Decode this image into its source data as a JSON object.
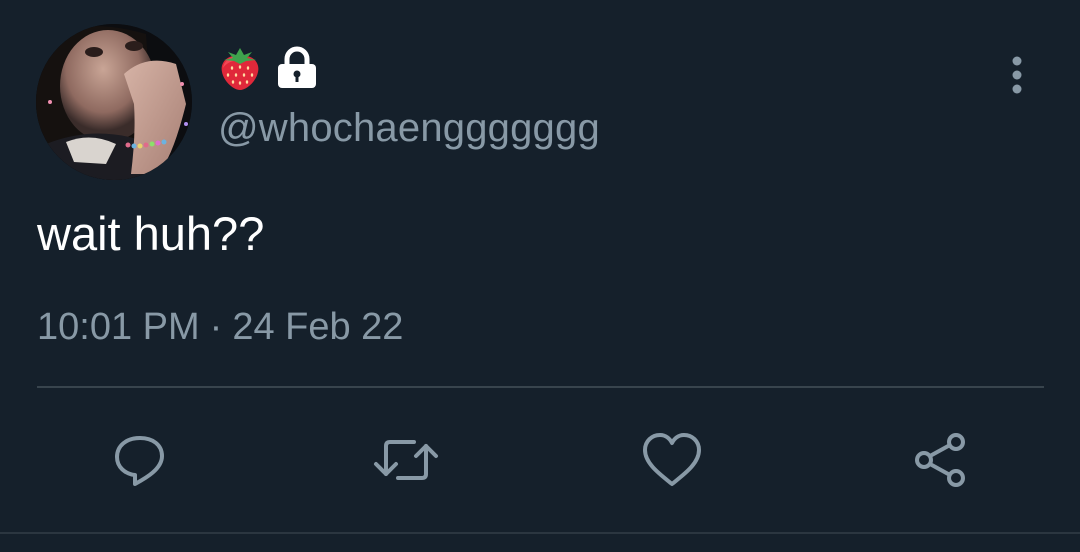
{
  "tweet": {
    "display_name_icons": [
      "strawberry-emoji",
      "lock-icon"
    ],
    "handle": "@whochaenggggggg",
    "text": "wait huh??",
    "time": "10:01 PM",
    "separator": "·",
    "date": "24 Feb 22"
  },
  "actions": [
    "reply-icon",
    "retweet-icon",
    "like-icon",
    "share-icon"
  ],
  "colors": {
    "background": "#15202b",
    "secondary_text": "#8899a6",
    "primary_text": "#ffffff",
    "divider": "#38444d"
  }
}
